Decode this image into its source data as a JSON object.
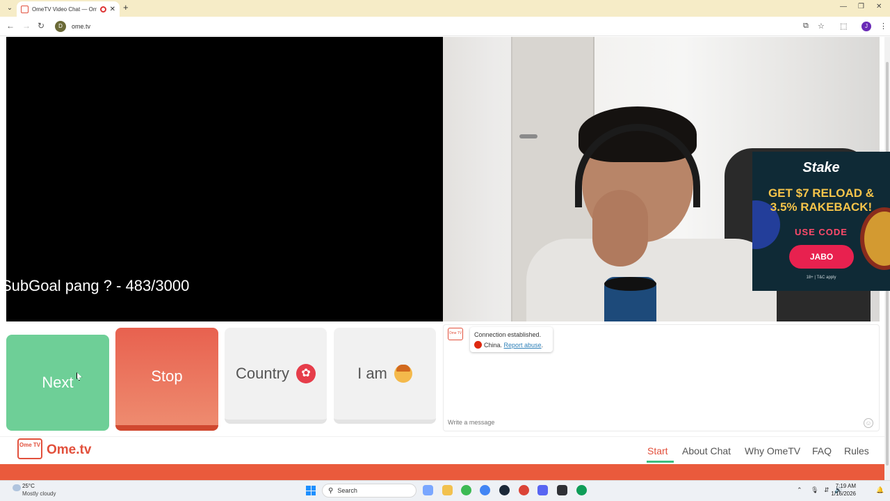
{
  "browser": {
    "tab_title": "OmeTV Video Chat — Ome",
    "url": "ome.tv",
    "site_icon_letter": "D",
    "profile_letter": "J"
  },
  "stream_overlay": {
    "text": "SubGoal pang ? - 483/3000"
  },
  "ad": {
    "brand": "Stake",
    "headline": "GET $7 RELOAD & 3.5% RAKEBACK!",
    "use_code_label": "USE CODE",
    "code": "JABO",
    "terms": "18+ | T&C apply"
  },
  "controls": {
    "next_label": "Next",
    "stop_label": "Stop",
    "country_label": "Country",
    "iam_label": "I am"
  },
  "chat": {
    "status": "Connection established.",
    "country": "China.",
    "report_link": "Report abuse",
    "report_suffix": ".",
    "input_placeholder": "Write a message",
    "logo_text": "Ome TV"
  },
  "footer": {
    "logo_text": "Ome TV",
    "brand": "Ome.tv",
    "nav": [
      "Start",
      "About Chat",
      "Why OmeTV",
      "FAQ",
      "Rules"
    ],
    "active": "Start"
  },
  "taskbar": {
    "weather_temp": "25°C",
    "weather_desc": "Mostly cloudy",
    "search_label": "Search",
    "time": "7:19 AM",
    "date": "1/16/2026"
  },
  "colors": {
    "brand": "#e2503c",
    "next": "#6ecf97",
    "stop": "#e8614f",
    "accent_underline": "#3dbf7f"
  }
}
